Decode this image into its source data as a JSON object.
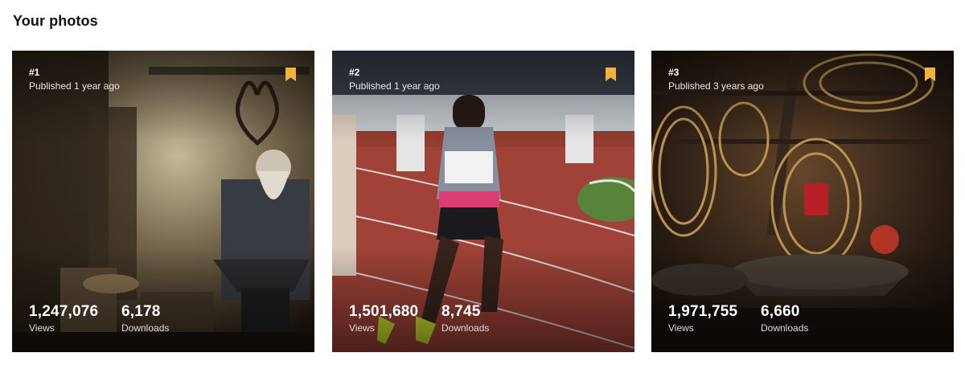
{
  "section_title": "Your photos",
  "colors": {
    "bookmark": "#f0b43c"
  },
  "photos": [
    {
      "rank": "#1",
      "published": "Published 1 year ago",
      "views": "1,247,076",
      "views_label": "Views",
      "downloads": "6,178",
      "downloads_label": "Downloads",
      "subject": "blacksmith-at-anvil"
    },
    {
      "rank": "#2",
      "published": "Published 1 year ago",
      "views": "1,501,680",
      "views_label": "Views",
      "downloads": "8,745",
      "downloads_label": "Downloads",
      "subject": "women-sprinters-on-track"
    },
    {
      "rank": "#3",
      "published": "Published 3 years ago",
      "views": "1,971,755",
      "views_label": "Views",
      "downloads": "6,660",
      "downloads_label": "Downloads",
      "subject": "hanging-incense-coils"
    }
  ]
}
